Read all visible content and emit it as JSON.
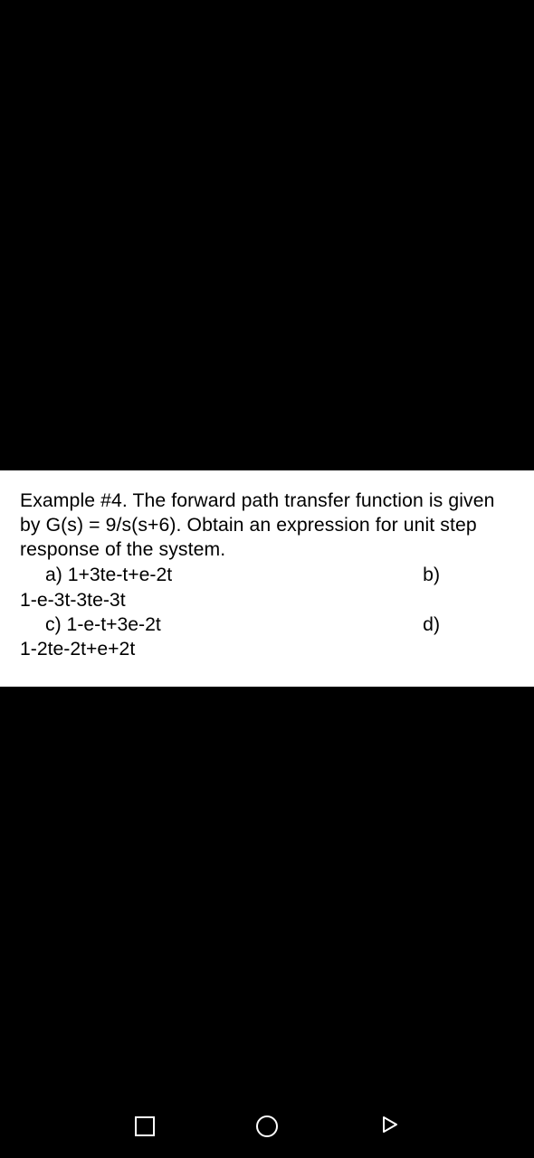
{
  "content": {
    "question": "Example #4. The forward path transfer function is given by G(s) = 9/s(s+6). Obtain an expression for unit step response of the system.",
    "options": {
      "a_label": "a) 1+3te-t+e-2t",
      "b_label": "b)",
      "b_continuation": "1-e-3t-3te-3t",
      "c_label": "c) 1-e-t+3e-2t",
      "d_label": "d)",
      "d_continuation": "1-2te-2t+e+2t"
    }
  },
  "nav": {
    "recent": "recent-apps",
    "home": "home",
    "back": "back"
  }
}
